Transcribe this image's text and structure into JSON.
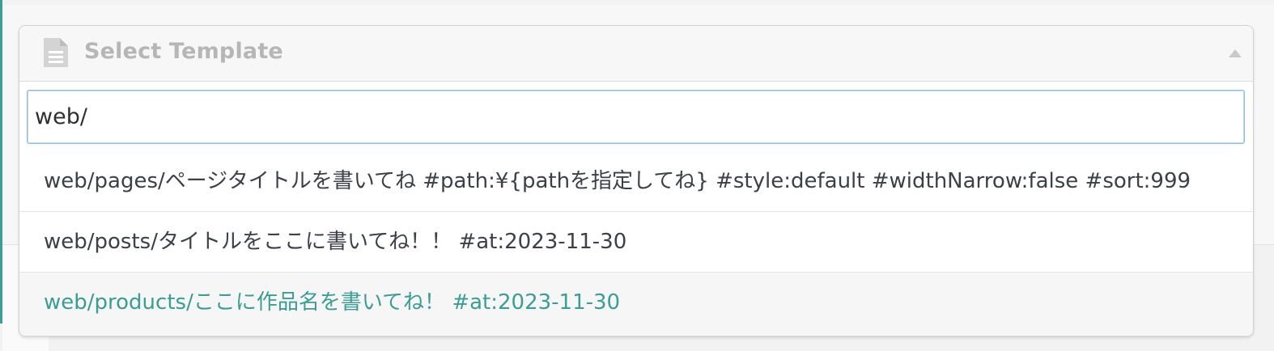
{
  "select": {
    "placeholder": "Select Template",
    "icon": "document-icon"
  },
  "search": {
    "value": "web/"
  },
  "options": [
    {
      "label": "web/pages/ページタイトルを書いてね #path:¥{pathを指定してね} #style:default #widthNarrow:false #sort:999"
    },
    {
      "label": "web/posts/タイトルをここに書いてね！！ #at:2023-11-30"
    },
    {
      "label": "web/products/ここに作品名を書いてね！ #at:2023-11-30"
    }
  ],
  "highlighted_index": 2,
  "colors": {
    "accent": "#3a9d96",
    "focus_border": "#8ec0e6",
    "text": "#3b4049",
    "placeholder": "#b6b6b6"
  }
}
